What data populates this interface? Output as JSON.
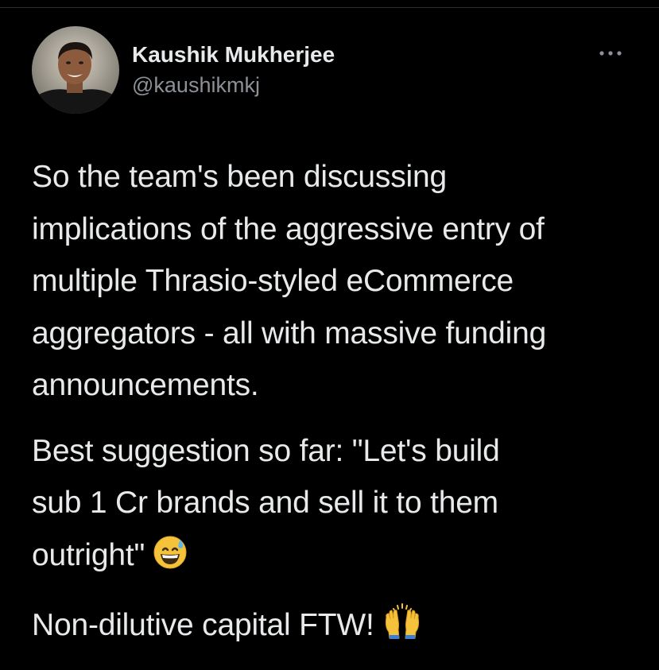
{
  "author": {
    "display_name": "Kaushik Mukherjee",
    "handle": "@kaushikmkj",
    "avatar_icon": "profile-photo"
  },
  "more_icon": "ellipsis-icon",
  "tweet": {
    "para1": [
      "So the team's been discussing",
      "implications of the aggressive entry of",
      "multiple Thrasio-styled eCommerce",
      "aggregators - all with massive funding",
      "announcements."
    ],
    "para2": [
      "Best suggestion so far: \"Let's build",
      "sub 1 Cr brands and sell it to them",
      "outright\""
    ],
    "para2_emoji": "grinning-face-with-sweat-icon",
    "para3": "Non-dilutive capital FTW!",
    "para3_emoji": "raising-hands-icon"
  },
  "colors": {
    "background": "#000000",
    "text": "#e7e9ea",
    "secondary_text": "#8b9197",
    "emoji_yellow": "#f5c33b"
  }
}
